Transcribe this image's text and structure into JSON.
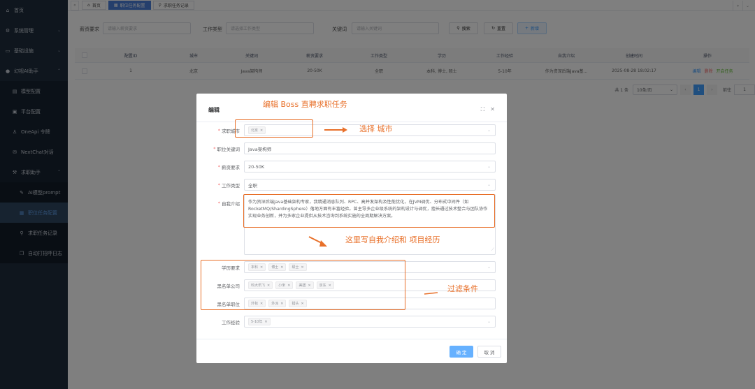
{
  "sidebar": {
    "items": [
      {
        "label": "首页",
        "icon": "home-icon",
        "glyph": "⌂"
      },
      {
        "label": "系统管理",
        "icon": "gear-icon",
        "glyph": "⚙"
      },
      {
        "label": "基础设施",
        "icon": "monitor-icon",
        "glyph": "▭"
      },
      {
        "label": "幻视AI助手",
        "icon": "apple-icon",
        "glyph": "●"
      },
      {
        "label": "模型配置",
        "icon": "model-icon",
        "glyph": "▤"
      },
      {
        "label": "平台配置",
        "icon": "lock-icon",
        "glyph": "▣"
      },
      {
        "label": "OneApi 令牌",
        "icon": "key-icon",
        "glyph": "♙"
      },
      {
        "label": "NextChat对话",
        "icon": "mail-icon",
        "glyph": "✉"
      },
      {
        "label": "求职助手",
        "icon": "tools-icon",
        "glyph": "⚒"
      },
      {
        "label": "AI模型prompt",
        "icon": "pen-icon",
        "glyph": "✎"
      },
      {
        "label": "职位任务配置",
        "icon": "briefcase-icon",
        "glyph": "▦"
      },
      {
        "label": "求职任务记录",
        "icon": "pin-icon",
        "glyph": "⚲"
      },
      {
        "label": "自动打招呼日志",
        "icon": "log-icon",
        "glyph": "❐"
      }
    ]
  },
  "tabs": [
    {
      "label": "首页",
      "icon": "⌂"
    },
    {
      "label": "职位任务配置",
      "icon": "▦"
    },
    {
      "label": "求职任务记录",
      "icon": "⚲"
    }
  ],
  "search": {
    "salary_label": "薪资要求",
    "salary_placeholder": "请输入薪资要求",
    "jobtype_label": "工作类型",
    "jobtype_placeholder": "请选择工作类型",
    "keyword_label": "关键词",
    "keyword_placeholder": "请输入关键词",
    "search_btn": "搜索",
    "reset_btn": "重置",
    "add_btn": "新增"
  },
  "table": {
    "headers": [
      "配置ID",
      "城市",
      "关键词",
      "薪资要求",
      "工作类型",
      "学历",
      "工作经验",
      "自我介绍",
      "创建时间",
      "操作"
    ],
    "rows": [
      {
        "id": "1",
        "city": "北京",
        "keyword": "Java架构师",
        "salary": "20-50K",
        "jobtype": "全职",
        "education": "本科, 博士, 硕士",
        "experience": "5-10年",
        "intro": "作为资深后端Java基...",
        "created": "2025-08-28 18:02:17",
        "ops": {
          "edit": "编辑",
          "del": "删除",
          "start": "开启任务"
        }
      }
    ]
  },
  "pager": {
    "total": "共 1 条",
    "size": "10条/页",
    "current": "1",
    "goto_label": "前往",
    "goto_value": "1"
  },
  "modal": {
    "title": "编辑",
    "city_label": "求职城市",
    "city_tags": [
      "北京"
    ],
    "keyword_label": "职位关键词",
    "keyword_value": "Java架构师",
    "salary_label": "薪资要求",
    "salary_value": "20-50K",
    "jobtype_label": "工作类型",
    "jobtype_value": "全职",
    "intro_label": "自我介绍",
    "intro_value": "作为资深后端Java基础架构专家，我精通消息队列、RPC、高并发架构及性能优化，在JVM调优、分布式中间件（如RocketMQ/ShardingSphere）落地方面有丰富经验。曾主导多企业级系统的架构设计与调优，擅长通过技术整合与团队协作实现业务创新，并为多家企业提供从技术咨询到系统实施的全周期解决方案。",
    "edu_label": "学历要求",
    "edu_tags": [
      "本科",
      "博士",
      "硕士"
    ],
    "blackco_label": "黑名单公司",
    "blackco_tags": [
      "科大讯飞",
      "小米",
      "美团",
      "京东"
    ],
    "blackpos_label": "黑名单职位",
    "blackpos_tags": [
      "外包",
      "外派",
      "猎头"
    ],
    "exp_label": "工作经验",
    "exp_tags": [
      "5-10年"
    ],
    "ok": "确 定",
    "cancel": "取 消"
  },
  "annotations": {
    "title": "编辑 Boss 直聘求职任务",
    "city": "选择 城市",
    "intro": "这里写自我介绍和 项目经历",
    "filter": "过滤条件"
  },
  "colors": {
    "accent": "#409eff",
    "annotation": "#e8702a",
    "sidebar": "#1f2d3d"
  }
}
